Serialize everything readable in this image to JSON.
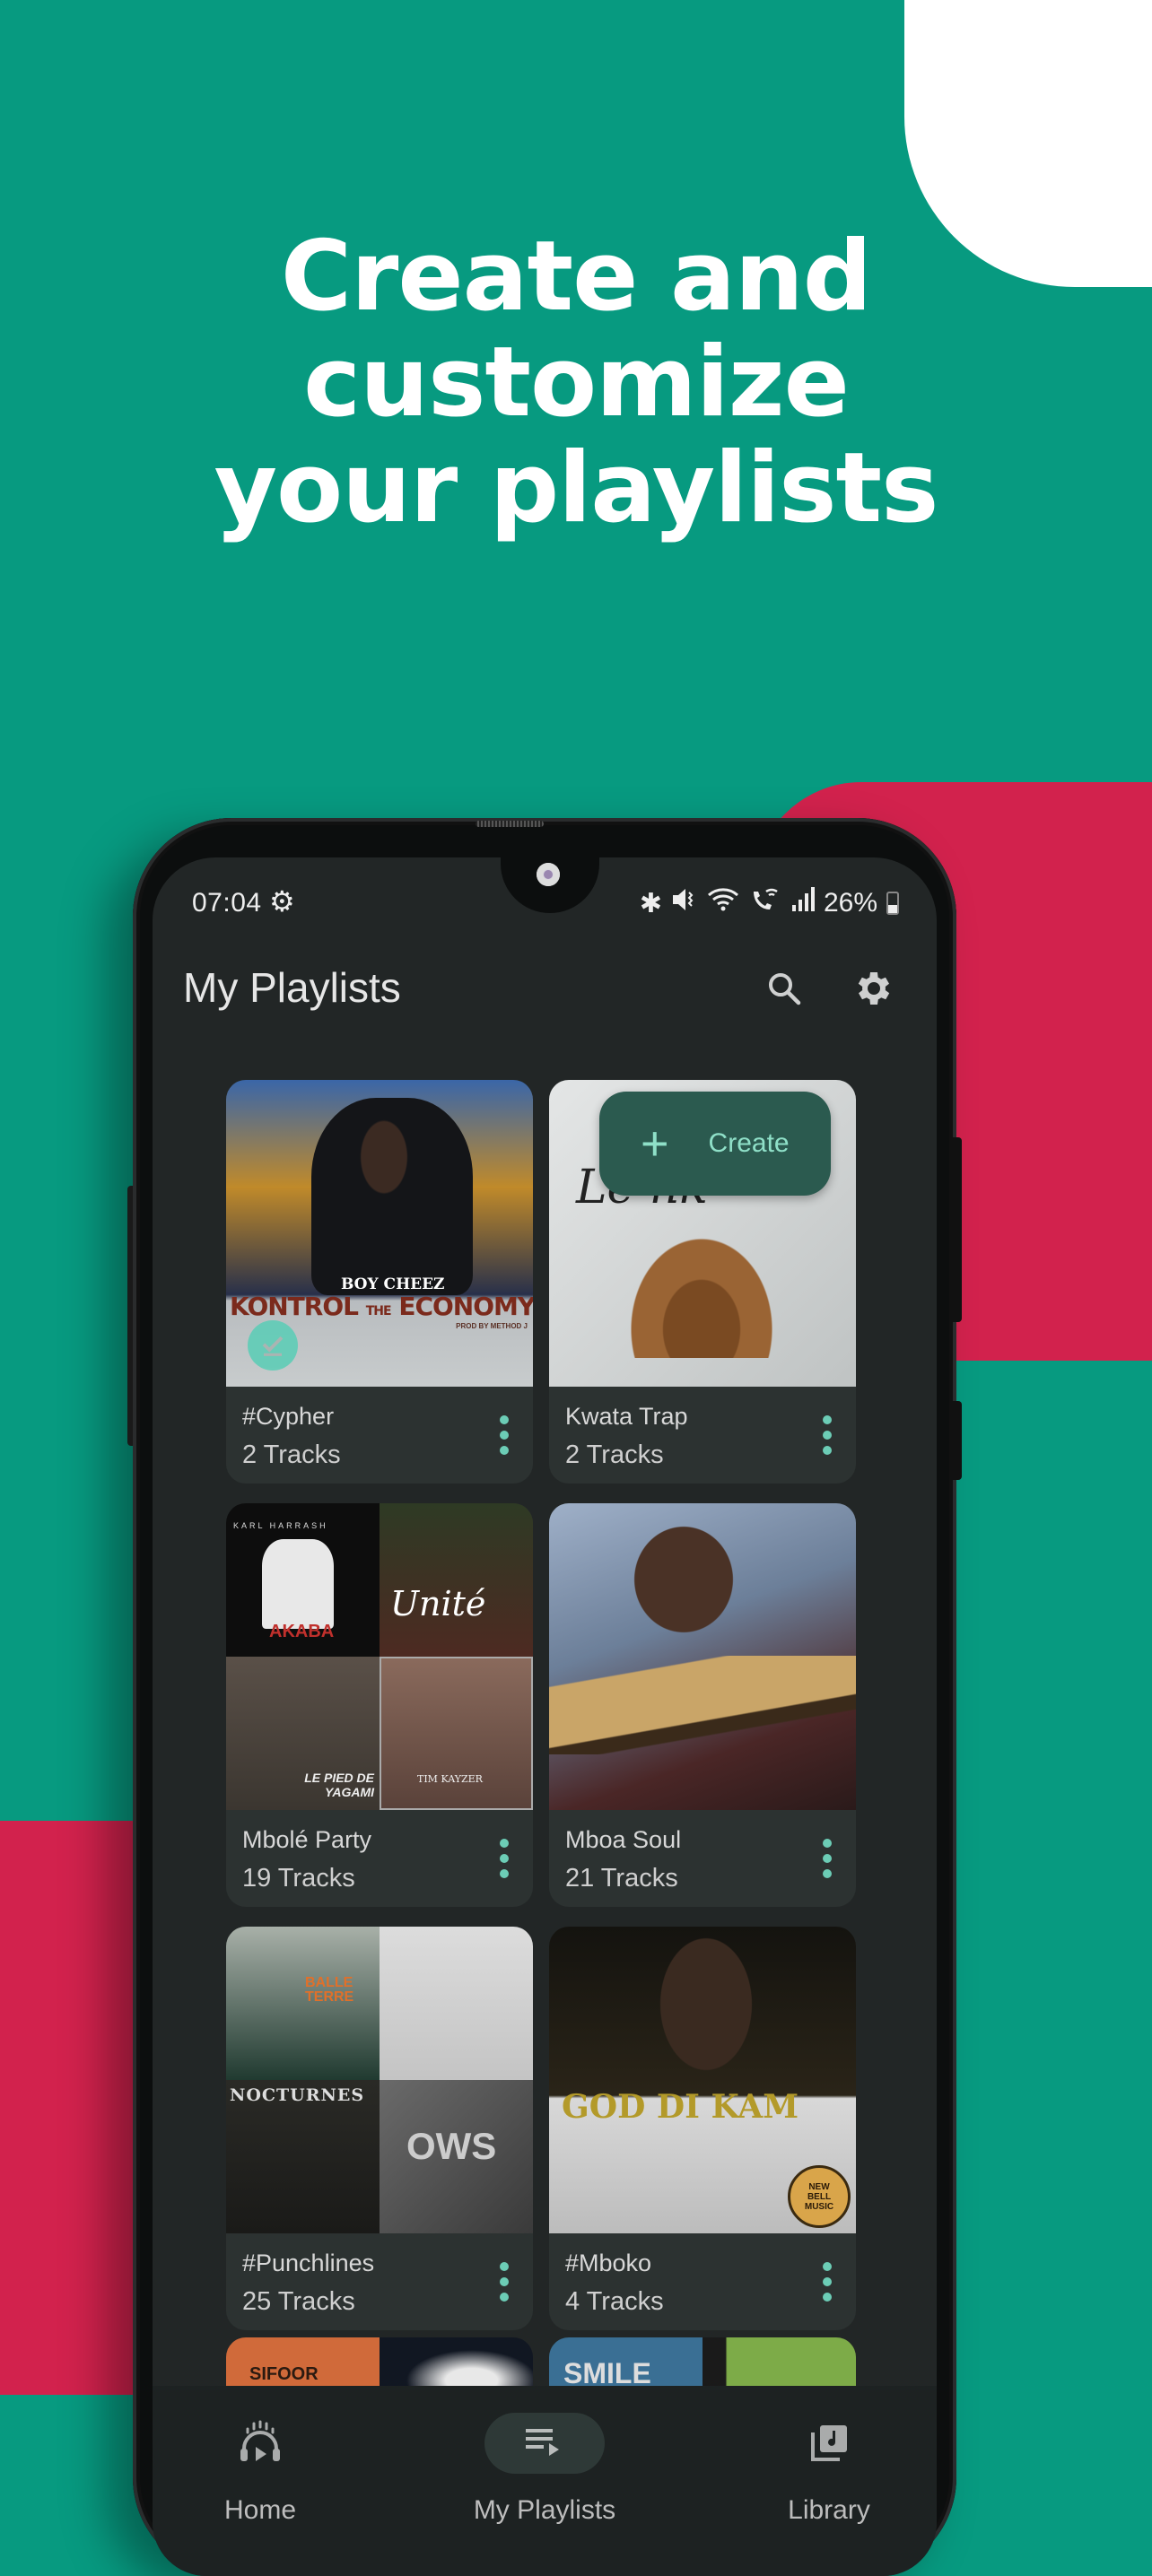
{
  "promo": {
    "headline_lines": [
      "Create and",
      "customize",
      "your playlists"
    ],
    "colors": {
      "background": "#079a80",
      "accent_red": "#d2224d",
      "white": "#ffffff"
    }
  },
  "status_bar": {
    "time": "07:04",
    "battery": "26%",
    "icons": [
      "bluetooth-icon",
      "mute-icon",
      "wifi-icon",
      "wifi-calling-icon",
      "signal-icon",
      "battery-icon"
    ]
  },
  "app_bar": {
    "title": "My Playlists",
    "actions": [
      "search-icon",
      "settings-icon"
    ]
  },
  "fab": {
    "icon": "plus-icon",
    "label": "Create"
  },
  "playlists": [
    {
      "title": "#Cypher",
      "count": "2 Tracks",
      "downloaded": true
    },
    {
      "title": "Kwata Trap",
      "count": "2 Tracks"
    },
    {
      "title": "Mbolé Party",
      "count": "19 Tracks"
    },
    {
      "title": "Mboa Soul",
      "count": "21 Tracks"
    },
    {
      "title": "#Punchlines",
      "count": "25 Tracks"
    },
    {
      "title": "#Mboko",
      "count": "4 Tracks"
    }
  ],
  "cover_text": {
    "cypher": [
      "BOY CHEEZ",
      "KONTROL",
      "THE",
      "ECONOMY",
      "PROD BY METHOD J"
    ],
    "kwata": [
      "Le nk"
    ],
    "mbole": [
      "KARL HARRASH",
      "AKABA",
      "Unité",
      "LE PIED DE YAGAMI",
      "TIM KAYZER"
    ],
    "punchlines": [
      "BALLE TERRE",
      "NOCTURNES",
      "OWS"
    ],
    "mboko": [
      "GOD DI KAM",
      "NEW BELL MUSIC"
    ],
    "partial": [
      "SIFOOR",
      "SMILE"
    ]
  },
  "bottom_nav": {
    "items": [
      {
        "label": "Home",
        "icon": "home-headphones-icon"
      },
      {
        "label": "My Playlists",
        "icon": "playlist-icon",
        "active": true
      },
      {
        "label": "Library",
        "icon": "library-music-icon"
      }
    ]
  }
}
